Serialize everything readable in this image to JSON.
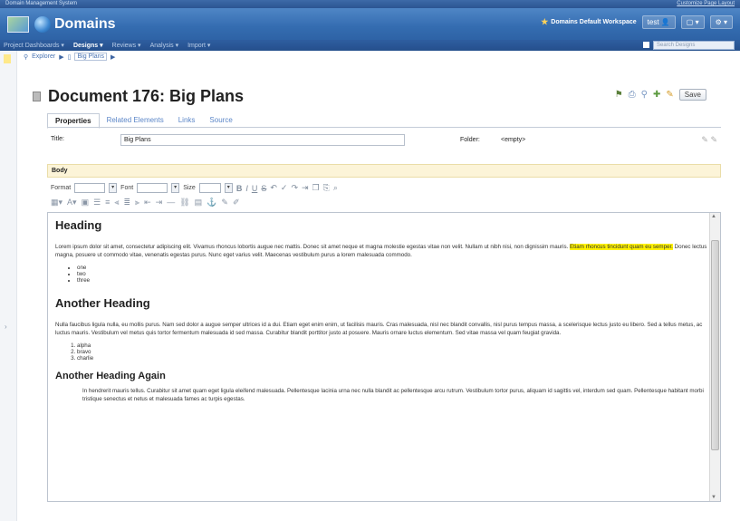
{
  "top_strip": {
    "left": "Domain Management System",
    "right": "Customize Page Layout"
  },
  "app": {
    "title": "Domains"
  },
  "header": {
    "workspace": "Domains Default Workspace",
    "user": "test",
    "buttons": [
      "▾",
      "▢ ▾",
      "⚙ ▾"
    ]
  },
  "nav": {
    "items": [
      "Project Dashboards ▾",
      "Designs ▾",
      "Reviews ▾",
      "Analysis ▾",
      "Import ▾"
    ],
    "search_placeholder": "Search Designs"
  },
  "breadcrumb": {
    "root": "Explorer",
    "item": "Big Plans"
  },
  "document": {
    "title": "Document 176: Big Plans",
    "save_label": "Save"
  },
  "tabs": [
    "Properties",
    "Related Elements",
    "Links",
    "Source"
  ],
  "fields": {
    "title_label": "Title:",
    "title_value": "Big Plans",
    "folder_label": "Folder:",
    "folder_value": "<empty>"
  },
  "body_label": "Body",
  "toolbar": {
    "format_label": "Format",
    "font_label": "Font",
    "size_label": "Size"
  },
  "content": {
    "h1": "Heading",
    "p1_before": "Lorem ipsum dolor sit amet, consectetur adipiscing elit. Vivamus rhoncus lobortis augue nec mattis. Donec sit amet neque et magna molestie egestas vitae non velit. Nullam ut nibh nisi, non dignissim mauris. ",
    "p1_highlight": "Etiam rhoncus tincidunt quam eu semper.",
    "p1_after": " Donec lectus magna, posuere ut commodo vitae, venenatis egestas purus. Nunc eget varius velit. Maecenas vestibulum purus a lorem malesuada commodo.",
    "list1": [
      "one",
      "two",
      "three"
    ],
    "h2": "Another Heading",
    "p2": "Nulla faucibus ligula nulla, eu mollis purus. Nam sed dolor a augue semper ultrices id a dui. Etiam eget enim enim, ut facilisis mauris. Cras malesuada, nisl nec blandit convallis, nisl purus tempus massa, a scelerisque lectus justo eu libero. Sed a tellus metus, ac luctus mauris. Vestibulum vel metus quis tortor fermentum malesuada id sed massa. Curabitur blandit porttitor justo at posuere. Mauris ornare luctus elementum. Sed vitae massa vel quam feugiat gravida.",
    "list2": [
      "alpha",
      "bravo",
      "charlie"
    ],
    "h3": "Another Heading Again",
    "p3": "In hendrerit mauris tellus. Curabitur sit amet quam eget ligula eleifend malesuada. Pellentesque lacinia urna nec nulla blandit ac pellentesque arcu rutrum. Vestibulum tortor purus, aliquam id sagittis vel, interdum sed quam. Pellentesque habitant morbi tristique senectus et netus et malesuada fames ac turpis egestas."
  }
}
